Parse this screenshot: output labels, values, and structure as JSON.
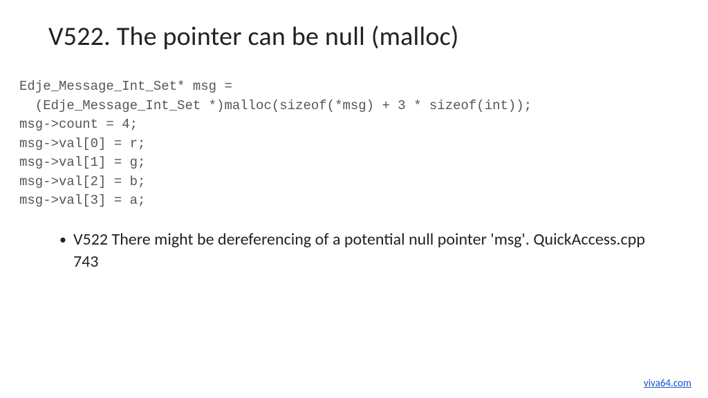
{
  "title": "V522. The pointer can be null (malloc)",
  "code": {
    "l1": "Edje_Message_Int_Set* msg =",
    "l2": "  (Edje_Message_Int_Set *)malloc(sizeof(*msg) + 3 * sizeof(int));",
    "l3": "msg->count = 4;",
    "l4": "msg->val[0] = r;",
    "l5": "msg->val[1] = g;",
    "l6": "msg->val[2] = b;",
    "l7": "msg->val[3] = a;"
  },
  "bullet": "V522 There might be dereferencing of a potential null pointer 'msg'. QuickAccess.cpp 743",
  "footer_link": "viva64.com"
}
